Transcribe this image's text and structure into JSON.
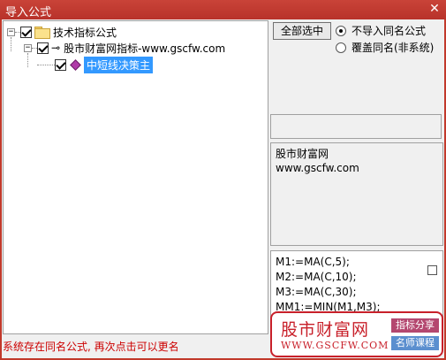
{
  "window": {
    "title": "导入公式",
    "close_glyph": "✕"
  },
  "tree": {
    "root": {
      "label": "技术指标公式",
      "expander": "−",
      "checked": true
    },
    "child": {
      "label": "股市财富网指标-www.gscfw.com",
      "expander": "−",
      "checked": true
    },
    "leaf": {
      "label": "中短线决策主",
      "checked": true,
      "selected": true
    }
  },
  "controls": {
    "select_all_label": "全部选中",
    "radio_skip_label": "不导入同名公式",
    "radio_overwrite_label": "覆盖同名(非系统)",
    "selected_radio": "skip"
  },
  "description": {
    "line1": "股市财富网",
    "line2": "www.gscfw.com"
  },
  "code_lines": [
    " M1:=MA(C,5);",
    "M2:=MA(C,10);",
    "M3:=MA(C,30);",
    "MM1:=MIN(M1,M3);"
  ],
  "status_text": "系统存在同名公式, 再次点击可以更名",
  "watermark": {
    "brand": "股市财富网",
    "url": "WWW.GSCFW.COM",
    "tag1": "指标分享",
    "tag2": "名师课程",
    "color": "#c8202a"
  },
  "colors": {
    "titlebar": "#c1392b",
    "selection": "#3399ff",
    "status": "#cc0000"
  }
}
